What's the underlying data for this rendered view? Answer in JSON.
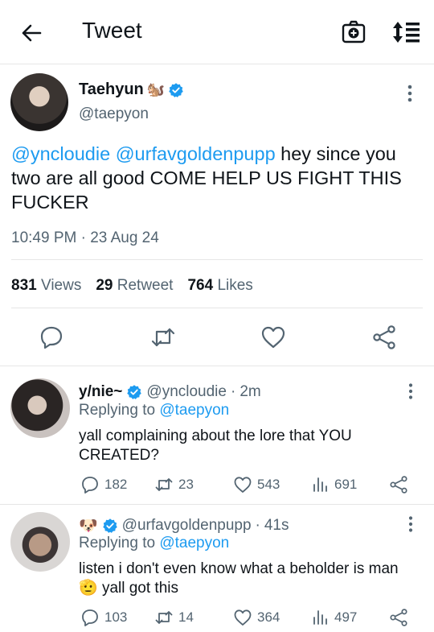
{
  "header": {
    "title": "Tweet",
    "icons": [
      "back-arrow-icon",
      "camera-plus-icon",
      "sort-icon"
    ]
  },
  "tweet": {
    "author_name": "Taehyun",
    "author_emoji": "🐿️",
    "author_handle": "@taepyon",
    "text_mention_1": "@yncloudie",
    "text_mention_2": "@urfavgoldenpupp",
    "text_body": " hey since you two are all good COME HELP US FIGHT THIS FUCKER",
    "timestamp": "10:49 PM · 23 Aug 24",
    "views_count": "831",
    "views_label": "Views",
    "retweet_count": "29",
    "retweet_label": "Retweet",
    "likes_count": "764",
    "likes_label": "Likes"
  },
  "replies": [
    {
      "name": "y/nie~",
      "handle": "@yncloudie",
      "time": "2m",
      "replying_prefix": "Replying to ",
      "replying_to": "@taepyon",
      "text": "yall complaining about the lore that YOU CREATED?",
      "replies": "182",
      "retweets": "23",
      "likes": "543",
      "views": "691"
    },
    {
      "name_emoji": "🐶",
      "handle": "@urfavgoldenpupp",
      "time": "41s",
      "replying_prefix": "Replying to ",
      "replying_to": "@taepyon",
      "text_line1": "listen i don't even know what a beholder is man",
      "text_emoji": "🫡",
      "text_line2": " yall got this",
      "replies": "103",
      "retweets": "14",
      "likes": "364",
      "views": "497"
    }
  ],
  "colors": {
    "accent": "#1d9bf0",
    "text": "#0f1419",
    "muted": "#536471",
    "divider": "#e6e6e6"
  }
}
